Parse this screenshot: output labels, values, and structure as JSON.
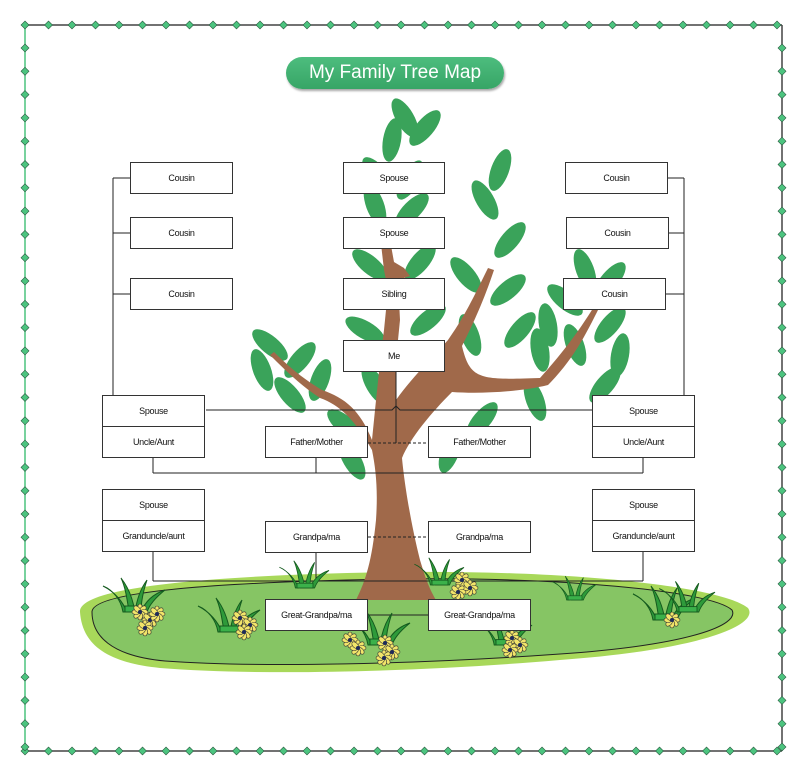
{
  "title": "My Family Tree Map",
  "colors": {
    "title_bg": "#3cb371",
    "border_green": "#4cc47f",
    "border_dark": "#444444",
    "leaf": "#3aa35a",
    "trunk": "#a0694a",
    "grass_light": "#a8d85a",
    "grass": "#86c564",
    "flower": "#f2e56a"
  },
  "members": {
    "cousin_l1": "Cousin",
    "cousin_l2": "Cousin",
    "cousin_l3": "Cousin",
    "spouse_c1": "Spouse",
    "spouse_c2": "Spouse",
    "sibling": "Sibling",
    "me": "Me",
    "cousin_r1": "Cousin",
    "cousin_r2": "Cousin",
    "cousin_r3": "Cousin",
    "spouse_ul": "Spouse",
    "uncle_aunt_l": "Uncle/Aunt",
    "father_mother_l": "Father/Mother",
    "father_mother_r": "Father/Mother",
    "spouse_ur": "Spouse",
    "uncle_aunt_r": "Uncle/Aunt",
    "spouse_gl": "Spouse",
    "granduncle_aunt_l": "Granduncle/aunt",
    "grandpa_ma_l": "Grandpa/ma",
    "grandpa_ma_r": "Grandpa/ma",
    "spouse_gr": "Spouse",
    "granduncle_aunt_r": "Granduncle/aunt",
    "great_grandpa_ma_l": "Great-Grandpa/ma",
    "great_grandpa_ma_r": "Great-Grandpa/ma"
  }
}
